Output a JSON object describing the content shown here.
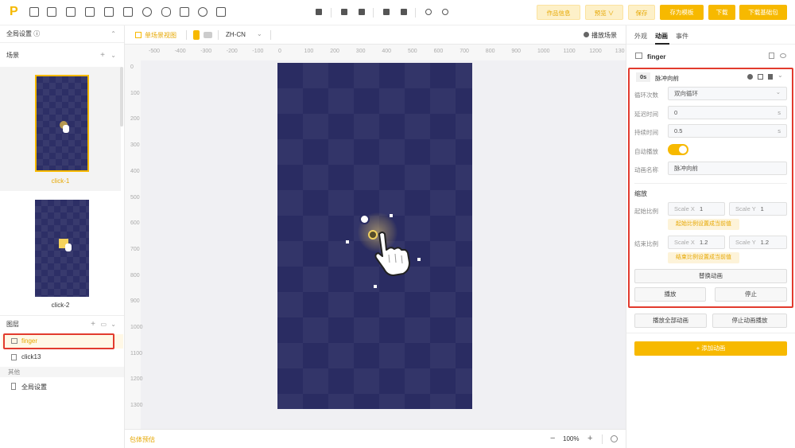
{
  "toolbar": {
    "logo": "P",
    "buttons": {
      "work_info": "作品信息",
      "preview": "预览 ∨",
      "save": "保存",
      "save_template": "存为模板",
      "download": "下载",
      "download_base": "下载基础包"
    }
  },
  "left_panel": {
    "global_settings": "全局设置 ⓘ",
    "scenes_title": "场景",
    "scenes": [
      {
        "label": "click-1"
      },
      {
        "label": "click-2"
      }
    ],
    "layers_title": "图层",
    "layers": [
      {
        "label": "finger"
      },
      {
        "label": "click13"
      }
    ],
    "other_title": "其他",
    "other_items": [
      {
        "label": "全局设置"
      }
    ]
  },
  "canvas": {
    "view_mode": "单场景视图",
    "language": "ZH-CN",
    "play_scene": "播放场景",
    "ruler_x": [
      "-500",
      "-400",
      "-300",
      "-200",
      "-100",
      "0",
      "100",
      "200",
      "300",
      "400",
      "500",
      "600",
      "700",
      "800",
      "900",
      "1000",
      "1100",
      "1200",
      "130"
    ],
    "ruler_y": [
      "0",
      "100",
      "200",
      "300",
      "400",
      "500",
      "600",
      "700",
      "800",
      "900",
      "1000",
      "1100",
      "1200",
      "1300"
    ],
    "bottom_left": "包体预估",
    "zoom": "100%",
    "zoom_minus": "−",
    "zoom_plus": "+"
  },
  "right_panel": {
    "tabs": [
      "外观",
      "动画",
      "事件"
    ],
    "element_name": "finger",
    "animation": {
      "time_badge": "0s",
      "name_header": "脉冲向前",
      "loop_label": "循环次数",
      "loop_value": "双向循环",
      "delay_label": "延迟时间",
      "delay_value": "0",
      "delay_unit": "s",
      "duration_label": "持续时间",
      "duration_value": "0.5",
      "duration_unit": "s",
      "autoplay_label": "自动播放",
      "anim_name_label": "动画名称",
      "anim_name_value": "脉冲向前",
      "scale_title": "缩放",
      "start_label": "起始比例",
      "start_x_label": "Scale X",
      "start_x": "1",
      "start_y_label": "Scale Y",
      "start_y": "1",
      "start_hint": "起始比例设置成当前值",
      "end_label": "结束比例",
      "end_x_label": "Scale X",
      "end_x": "1.2",
      "end_y_label": "Scale Y",
      "end_y": "1.2",
      "end_hint": "结束比例设置成当前值",
      "replace_btn": "替换动画",
      "play_btn": "播放",
      "stop_btn": "停止"
    },
    "play_all": "播放全部动画",
    "stop_all": "停止动画播放",
    "add_anim": "+ 添加动画"
  },
  "colors": {
    "accent": "#f7b900",
    "stage": "#2a2c62",
    "highlight": "#e23b2e"
  }
}
